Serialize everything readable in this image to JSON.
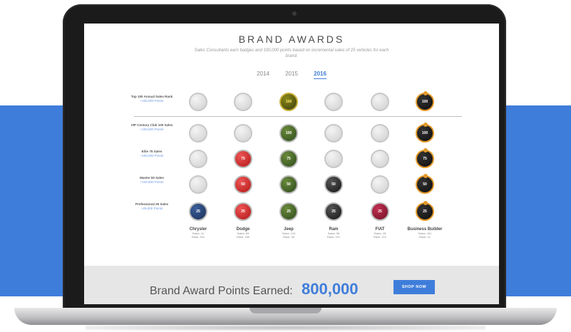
{
  "page": {
    "title": "BRAND AWARDS",
    "subtitle": "Sales Consultants earn badges and 100,000 points based on incremental sales of 25 vehicles for each brand.",
    "years": [
      "2014",
      "2015",
      "2016"
    ],
    "active_year": "2016"
  },
  "rows": [
    {
      "label": "Top 100 Annual Sales Rank",
      "points": "+100,000 Points"
    },
    {
      "label": "VIP Century Club 100 Sales",
      "points": "+100,000 Points"
    },
    {
      "label": "Elite 75 Sales",
      "points": "+100,000 Points"
    },
    {
      "label": "Master 50 Sales",
      "points": "+100,000 Points"
    },
    {
      "label": "Professional 25 Sales",
      "points": "+25,000 Points"
    }
  ],
  "brands": [
    {
      "name": "Chrysler",
      "sales": "Sales: 41",
      "rank": "Rank: 341"
    },
    {
      "name": "Dodge",
      "sales": "Sales: 83",
      "rank": "Rank: 180"
    },
    {
      "name": "Jeep",
      "sales": "Sales: 124",
      "rank": "Rank: 36"
    },
    {
      "name": "Ram",
      "sales": "Sales: 58",
      "rank": "Rank: 201"
    },
    {
      "name": "FIAT",
      "sales": "Sales: 28",
      "rank": "Rank: 112"
    },
    {
      "name": "Business Builder",
      "sales": "Sales: 161",
      "rank": "Rank: 21"
    }
  ],
  "badges": [
    [
      "",
      "",
      "100",
      "",
      "",
      "100"
    ],
    [
      "",
      "",
      "100",
      "",
      "",
      "100"
    ],
    [
      "",
      "75",
      "75",
      "",
      "",
      "75"
    ],
    [
      "",
      "50",
      "50",
      "50",
      "",
      "50"
    ],
    [
      "25",
      "25",
      "25",
      "25",
      "25",
      "25"
    ]
  ],
  "footer": {
    "label": "Brand Award Points Earned:",
    "value": "800,000",
    "button": "SHOP NOW"
  },
  "colors": {
    "accent": "#3f7ddb",
    "background_band": "#3f7ddb"
  }
}
